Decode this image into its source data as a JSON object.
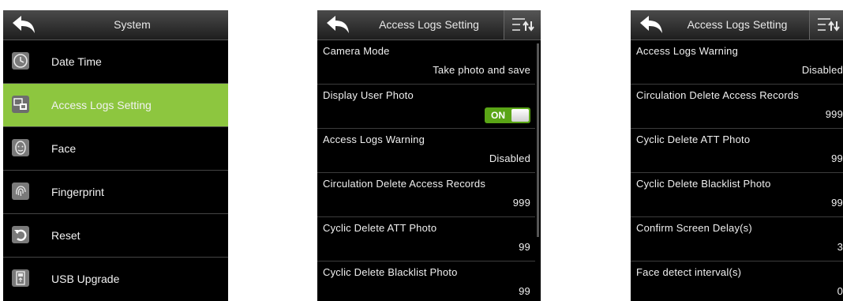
{
  "screen1": {
    "title": "System",
    "menu": [
      {
        "label": "Date Time",
        "icon": "clock-icon",
        "active": false
      },
      {
        "label": "Access Logs Setting",
        "icon": "access-logs-icon",
        "active": true
      },
      {
        "label": "Face",
        "icon": "face-icon",
        "active": false
      },
      {
        "label": "Fingerprint",
        "icon": "fingerprint-icon",
        "active": false
      },
      {
        "label": "Reset",
        "icon": "reset-icon",
        "active": false
      },
      {
        "label": "USB Upgrade",
        "icon": "usb-icon",
        "active": false
      }
    ]
  },
  "screen2": {
    "title": "Access Logs Setting",
    "settings": [
      {
        "label": "Camera Mode",
        "value": "Take photo and save"
      },
      {
        "label": "Display User Photo",
        "toggle_text": "ON",
        "toggle_state": true
      },
      {
        "label": "Access Logs Warning",
        "value": "Disabled"
      },
      {
        "label": "Circulation Delete Access Records",
        "value": "999"
      },
      {
        "label": "Cyclic Delete ATT Photo",
        "value": "99"
      },
      {
        "label": "Cyclic Delete Blacklist Photo",
        "value": "99"
      }
    ]
  },
  "screen3": {
    "title": "Access Logs Setting",
    "settings": [
      {
        "label": "Access Logs Warning",
        "value": "Disabled"
      },
      {
        "label": "Circulation Delete Access Records",
        "value": "999"
      },
      {
        "label": "Cyclic Delete ATT Photo",
        "value": "99"
      },
      {
        "label": "Cyclic Delete Blacklist Photo",
        "value": "99"
      },
      {
        "label": "Confirm Screen Delay(s)",
        "value": "3"
      },
      {
        "label": "Face detect interval(s)",
        "value": "0"
      }
    ]
  },
  "colors": {
    "active_item": "#8dc63f",
    "toggle_on": "#5aa516",
    "screen_bg": "#000000"
  }
}
